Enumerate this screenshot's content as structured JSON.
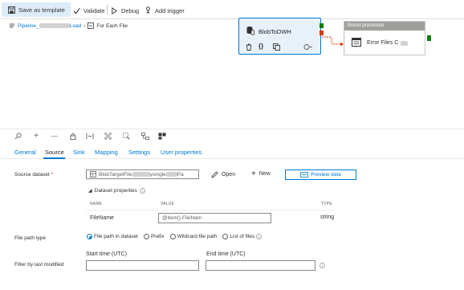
{
  "toolbar": {
    "save_as_template": "Save as template",
    "validate": "Validate",
    "debug": "Debug",
    "add_trigger": "Add trigger"
  },
  "breadcrumb": {
    "pipeline_prefix": "Pipeline_",
    "pipeline_suffix": "Load",
    "activity": "For Each File"
  },
  "canvas": {
    "activity_name": "BlobToDWH",
    "stored_procedure": {
      "header": "Stored procedure",
      "name_prefix": "Error Files C"
    }
  },
  "tabs": [
    "General",
    "Source",
    "Sink",
    "Mapping",
    "Settings",
    "User properties"
  ],
  "active_tab": "Source",
  "source": {
    "dataset_label": "Source dataset",
    "required_mark": "*",
    "dataset_value_prefix": "BlobTargetFile",
    "dataset_value_mid": "ysingle",
    "dataset_value_suffix": "Pa",
    "open_label": "Open",
    "new_label": "New",
    "preview_label": "Preview data",
    "dataset_properties_label": "Dataset properties",
    "columns": {
      "name": "NAME",
      "value": "VALUE",
      "type": "TYPE"
    },
    "properties": [
      {
        "name": "FileName",
        "value": "@item().FileNam",
        "type": "string"
      }
    ],
    "file_path_type_label": "File path type",
    "file_path_options": [
      "File path in dataset",
      "Prefix",
      "Wildcard file path",
      "List of files"
    ],
    "file_path_selected": "File path in dataset",
    "filter_label": "Filter by last modified",
    "start_time_label": "Start time (UTC)",
    "end_time_label": "End time (UTC)"
  },
  "colors": {
    "accent": "#0078d4",
    "success": "#107c10",
    "failure": "#d83b01"
  }
}
